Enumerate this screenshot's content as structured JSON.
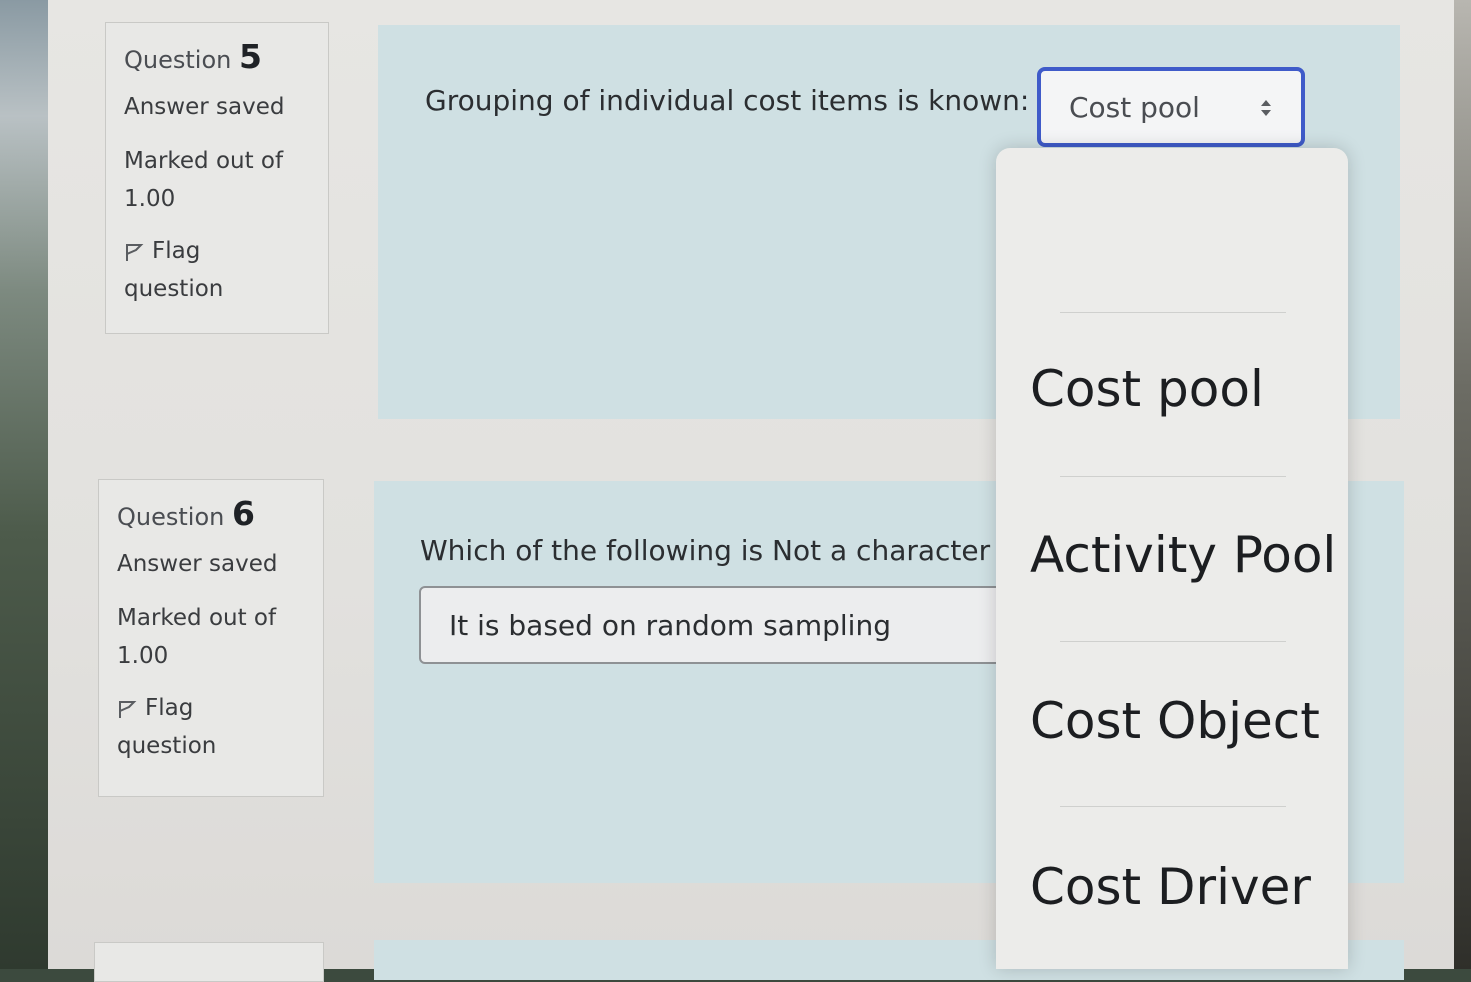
{
  "question5": {
    "label": "Question",
    "number": "5",
    "state": "Answer saved",
    "marked_line1": "Marked out of",
    "marked_line2": "1.00",
    "flag_line1": "Flag",
    "flag_line2": "question",
    "text": "Grouping of individual cost items is known:",
    "selected": "Cost pool"
  },
  "question6": {
    "label": "Question",
    "number": "6",
    "state": "Answer saved",
    "marked_line1": "Marked out of",
    "marked_line2": "1.00",
    "flag_line1": "Flag",
    "flag_line2": "question",
    "text": "Which of the following is Not a character",
    "answer": "It is based on random sampling"
  },
  "dropdown": {
    "options": [
      "",
      "Cost pool",
      "Activity Pool",
      "Cost Object",
      "Cost Driver"
    ]
  },
  "colors": {
    "select_border": "#3f5bc9",
    "panel_bg": "#cfe0e3"
  }
}
